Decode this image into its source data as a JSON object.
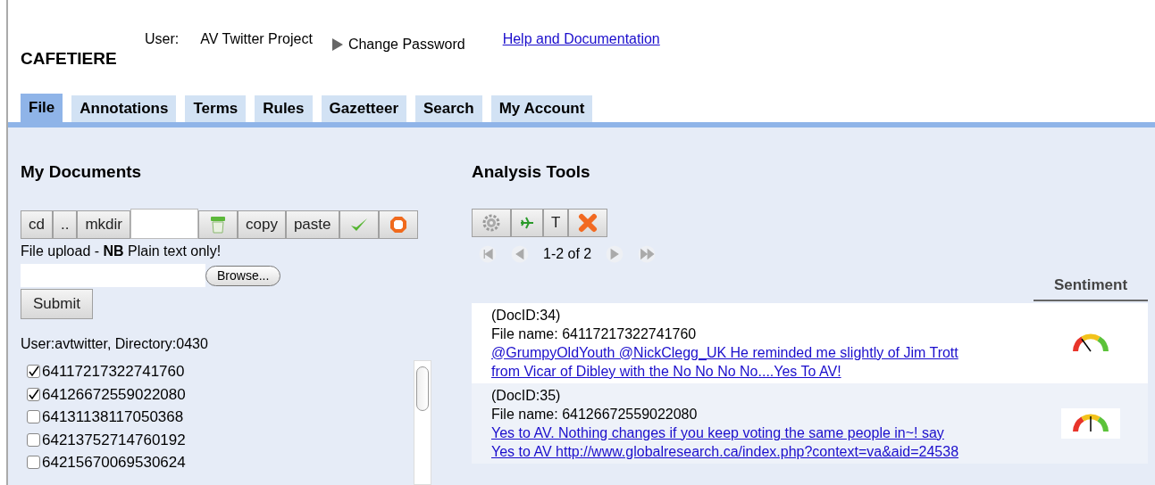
{
  "header": {
    "app_title": "CAFETIERE",
    "user_label": "User:",
    "user_name": "AV Twitter Project",
    "change_password": "Change Password",
    "help_link": "Help and Documentation"
  },
  "tabs": [
    {
      "label": "File",
      "selected": true
    },
    {
      "label": "Annotations",
      "selected": false
    },
    {
      "label": "Terms",
      "selected": false
    },
    {
      "label": "Rules",
      "selected": false
    },
    {
      "label": "Gazetteer",
      "selected": false
    },
    {
      "label": "Search",
      "selected": false
    },
    {
      "label": "My Account",
      "selected": false
    }
  ],
  "documents": {
    "title": "My Documents",
    "toolbar": [
      {
        "kind": "text",
        "label": "cd"
      },
      {
        "kind": "text",
        "label": ".."
      },
      {
        "kind": "text",
        "label": "mkdir"
      },
      {
        "kind": "field"
      },
      {
        "kind": "bin"
      },
      {
        "kind": "text",
        "label": "copy"
      },
      {
        "kind": "text",
        "label": "paste"
      },
      {
        "kind": "tick"
      },
      {
        "kind": "stop"
      }
    ],
    "upload_note": "File upload - **NB** Plain text only!",
    "browse": "Browse...",
    "submit": "Submit",
    "location": "User:avtwitter, Directory:0430",
    "files": [
      {
        "name": "64117217322741760",
        "checked": true
      },
      {
        "name": "64126672559022080",
        "checked": true
      },
      {
        "name": "64131138117050368",
        "checked": false
      },
      {
        "name": "64213752714760192",
        "checked": false
      },
      {
        "name": "64215670069530624",
        "checked": false
      }
    ]
  },
  "analysis": {
    "title": "Analysis Tools",
    "toolbar": [
      {
        "kind": "gear"
      },
      {
        "kind": "plane"
      },
      {
        "kind": "text",
        "label": "T"
      },
      {
        "kind": "cross"
      }
    ],
    "pagination": "1-2 of 2",
    "sentiment_header": "Sentiment",
    "rows": [
      {
        "doc_id": "(DocID:34)",
        "file_name": "File name: 64117217322741760",
        "text_lines": [
          "@GrumpyOldYouth @NickClegg_UK He reminded me slightly of Jim Trott",
          "from Vicar of Dibley with the No No No No....Yes To AV!"
        ],
        "kind": "negative"
      },
      {
        "doc_id": "(DocID:35)",
        "file_name": "File name: 64126672559022080",
        "text_lines": [
          "Yes to AV. Nothing changes if you keep voting the same people in~! say",
          "Yes to AV http://www.globalresearch.ca/index.php?context=va&aid=24538"
        ],
        "kind": "neutral"
      }
    ]
  }
}
